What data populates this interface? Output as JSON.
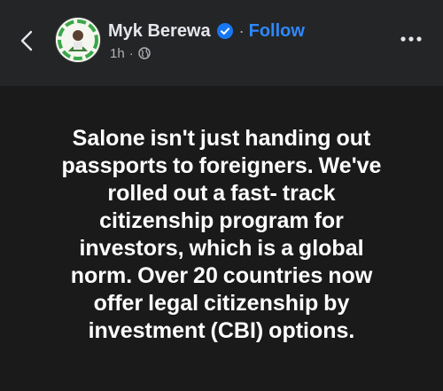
{
  "header": {
    "author_name": "Myk Berewa",
    "separator": "·",
    "follow_label": "Follow",
    "timestamp": "1h",
    "meta_separator": "·",
    "icons": {
      "back": "chevron-left-icon",
      "verified": "verified-badge-icon",
      "audience": "globe-icon",
      "more": "more-horizontal-icon"
    }
  },
  "post": {
    "lines": [
      "Salone isn't just handing out",
      "passports to foreigners. We've",
      "rolled out a fast- track",
      "citizenship program for",
      "investors, which is a global",
      "norm. Over 20 countries now",
      "offer legal citizenship by",
      "investment (CBI) options."
    ]
  },
  "colors": {
    "header_bg": "#242526",
    "body_bg": "#1a1a1a",
    "text_primary": "#e4e6eb",
    "text_secondary": "#b0b3b8",
    "link_blue": "#2d88ff",
    "verified_blue": "#1877f2"
  }
}
